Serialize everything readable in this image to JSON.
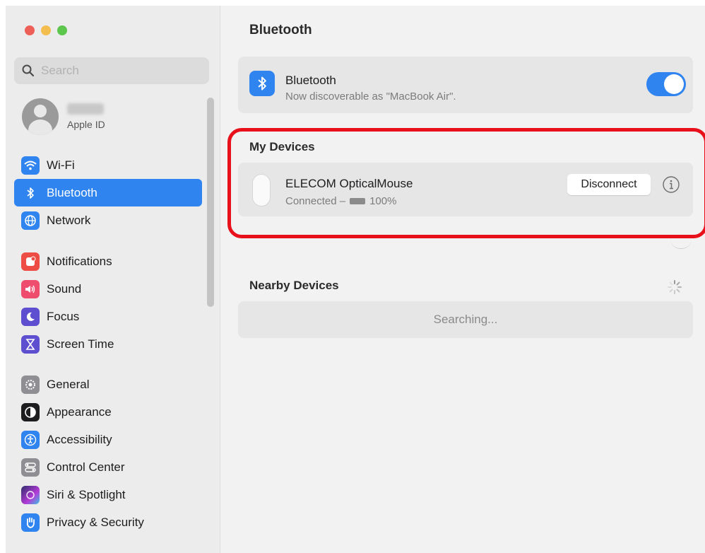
{
  "window": {
    "title": "Bluetooth"
  },
  "sidebar": {
    "search_placeholder": "Search",
    "profile": {
      "label": "Apple ID"
    },
    "groups": [
      [
        {
          "label": "Wi-Fi",
          "icon": "wifi-icon",
          "color": "#2f84ef",
          "selected": false
        },
        {
          "label": "Bluetooth",
          "icon": "bluetooth-icon",
          "color": "#2f84ef",
          "selected": true
        },
        {
          "label": "Network",
          "icon": "globe-icon",
          "color": "#2f84ef",
          "selected": false
        }
      ],
      [
        {
          "label": "Notifications",
          "icon": "bell-icon",
          "color": "#ee4d45",
          "selected": false
        },
        {
          "label": "Sound",
          "icon": "speaker-icon",
          "color": "#ee4d6d",
          "selected": false
        },
        {
          "label": "Focus",
          "icon": "moon-icon",
          "color": "#5d4fd0",
          "selected": false
        },
        {
          "label": "Screen Time",
          "icon": "hourglass-icon",
          "color": "#5d4fd0",
          "selected": false
        }
      ],
      [
        {
          "label": "General",
          "icon": "gear-icon",
          "color": "#8e8e93",
          "selected": false
        },
        {
          "label": "Appearance",
          "icon": "appearance-icon",
          "color": "#1d1d1f",
          "selected": false
        },
        {
          "label": "Accessibility",
          "icon": "accessibility-icon",
          "color": "#2f84ef",
          "selected": false
        },
        {
          "label": "Control Center",
          "icon": "control-center-icon",
          "color": "#8e8e93",
          "selected": false
        },
        {
          "label": "Siri & Spotlight",
          "icon": "siri-icon",
          "color": "#b33ad6",
          "selected": false
        },
        {
          "label": "Privacy & Security",
          "icon": "hand-icon",
          "color": "#2f84ef",
          "selected": false
        }
      ]
    ]
  },
  "main": {
    "title": "Bluetooth",
    "bluetooth_card": {
      "title": "Bluetooth",
      "subtitle": "Now discoverable as \"MacBook Air\".",
      "toggle_on": true
    },
    "my_devices": {
      "heading": "My Devices",
      "device": {
        "name": "ELECOM OpticalMouse",
        "status": "Connected –",
        "battery": "100%",
        "button": "Disconnect"
      }
    },
    "nearby_devices": {
      "heading": "Nearby Devices",
      "status": "Searching..."
    }
  },
  "colors": {
    "accent": "#2f84ef",
    "highlight": "#e8101a"
  }
}
